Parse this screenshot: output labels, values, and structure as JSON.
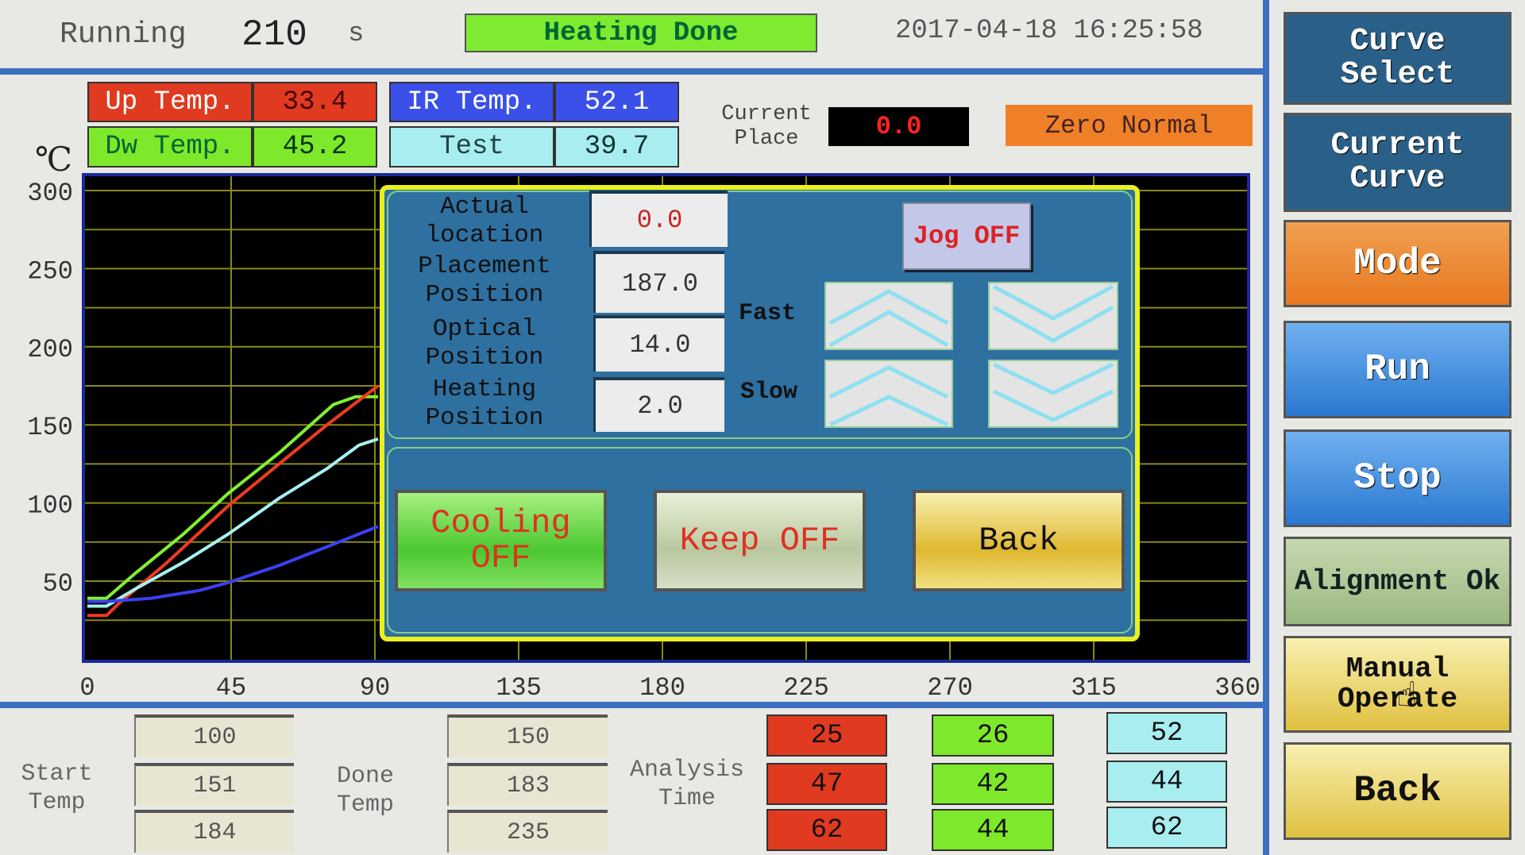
{
  "header": {
    "running_label": "Running",
    "running_value": "210",
    "running_unit": "s",
    "status": "Heating Done",
    "datetime": "2017-04-18 16:25:58"
  },
  "readouts": {
    "up_temp": {
      "label": "Up Temp.",
      "value": "33.4"
    },
    "dw_temp": {
      "label": "Dw Temp.",
      "value": "45.2"
    },
    "ir_temp": {
      "label": "IR Temp.",
      "value": "52.1"
    },
    "test": {
      "label": "Test",
      "value": "39.7"
    },
    "current_place": {
      "label": "Current Place",
      "value": "0.0"
    },
    "zero_status": "Zero Normal"
  },
  "colors": {
    "up": "#e03a20",
    "dw": "#7ee82a",
    "ir": "#3a50e8",
    "test": "#a8eef0",
    "status": "#7eea30",
    "zero": "#f08028"
  },
  "chart_data": {
    "type": "line",
    "ylabel": "℃",
    "xlim": [
      0,
      360
    ],
    "ylim": [
      0,
      300
    ],
    "x_ticks": [
      0,
      45,
      90,
      135,
      180,
      225,
      270,
      315,
      360
    ],
    "y_ticks": [
      50,
      100,
      150,
      200,
      250,
      300
    ],
    "grid": true,
    "series": [
      {
        "color": "#80f030",
        "points": [
          [
            0,
            39
          ],
          [
            6,
            39
          ],
          [
            15,
            55
          ],
          [
            30,
            80
          ],
          [
            44,
            106
          ],
          [
            60,
            132
          ],
          [
            77,
            163
          ],
          [
            84,
            168
          ],
          [
            91,
            168
          ]
        ]
      },
      {
        "color": "#f03a20",
        "points": [
          [
            0,
            28
          ],
          [
            6,
            28
          ],
          [
            10,
            36
          ],
          [
            25,
            62
          ],
          [
            44,
            98
          ],
          [
            60,
            125
          ],
          [
            75,
            150
          ],
          [
            91,
            175
          ]
        ]
      },
      {
        "color": "#a8f0f0",
        "points": [
          [
            0,
            34
          ],
          [
            6,
            34
          ],
          [
            15,
            45
          ],
          [
            30,
            62
          ],
          [
            44,
            80
          ],
          [
            60,
            103
          ],
          [
            75,
            122
          ],
          [
            85,
            137
          ],
          [
            91,
            141
          ]
        ]
      },
      {
        "color": "#3a40f0",
        "points": [
          [
            0,
            37
          ],
          [
            6,
            37
          ],
          [
            20,
            39
          ],
          [
            35,
            44
          ],
          [
            44,
            49
          ],
          [
            60,
            60
          ],
          [
            75,
            72
          ],
          [
            91,
            85
          ]
        ]
      }
    ]
  },
  "dialog": {
    "actual_label": "Actual location",
    "actual_value": "0.0",
    "placement_label": "Placement Position",
    "placement_value": "187.0",
    "optical_label": "Optical Position",
    "optical_value": "14.0",
    "heating_label": "Heating Position",
    "heating_value": "2.0",
    "jog": "Jog OFF",
    "fast": "Fast",
    "slow": "Slow",
    "cooling": "Cooling OFF",
    "keep": "Keep OFF",
    "back": "Back"
  },
  "sidebar": {
    "curve_select": "Curve Select",
    "current_curve": "Current Curve",
    "mode": "Mode",
    "run": "Run",
    "stop": "Stop",
    "alignment": "Alignment Ok",
    "manual": "Manual Operate",
    "back": "Back"
  },
  "bottom": {
    "start_label": "Start Temp",
    "start_values": [
      "100",
      "151",
      "184"
    ],
    "done_label": "Done Temp",
    "done_values": [
      "150",
      "183",
      "235"
    ],
    "analysis_label": "Analysis Time",
    "red_values": [
      "25",
      "47",
      "62"
    ],
    "green_values": [
      "26",
      "42",
      "44"
    ],
    "cyan_values": [
      "52",
      "44",
      "62"
    ]
  }
}
